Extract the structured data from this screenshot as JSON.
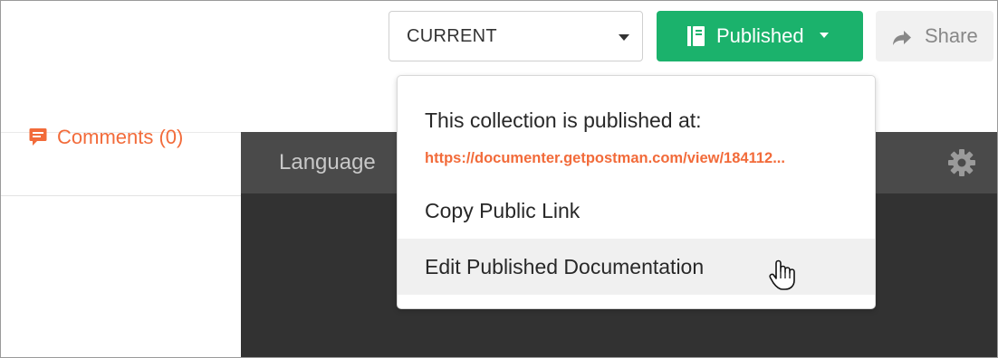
{
  "toolbar": {
    "version_value": "CURRENT",
    "publish_label": "Published",
    "share_label": "Share"
  },
  "sidebar": {
    "comments_label": "Comments (0)"
  },
  "code_panel": {
    "language_label": "Language"
  },
  "publish_menu": {
    "heading": "This collection is published at:",
    "url": "https://documenter.getpostman.com/view/184112...",
    "items": [
      {
        "label": "Copy Public Link"
      },
      {
        "label": "Edit Published Documentation"
      }
    ]
  },
  "icons": {
    "publish": "book-icon",
    "share": "share-arrow-icon",
    "comments": "comment-icon",
    "settings": "gear-icon",
    "pointer": "hand-cursor-icon"
  },
  "colors": {
    "publish_green": "#1bb26c",
    "accent_orange": "#f26b3a",
    "code_header": "#4a4a4a",
    "code_bg": "#323232",
    "menu_hover": "#f0f0f0"
  }
}
